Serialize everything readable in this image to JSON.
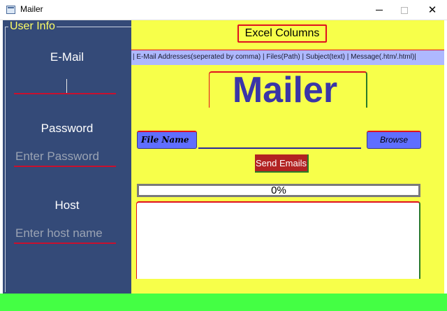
{
  "window": {
    "title": "Mailer"
  },
  "user_info": {
    "group_title": "User Info",
    "email_label": "E-Mail",
    "email_value": "",
    "password_label": "Password",
    "password_placeholder": "Enter Password",
    "host_label": "Host",
    "host_placeholder": "Enter host name"
  },
  "main": {
    "excel_button": "Excel  Columns",
    "columns_text": "| E-Mail Addresses(seperated by comma) | Files(Path) |  Subject(text) |  Message(.htm/.html)|",
    "mailer_title": "Mailer",
    "file_name_label": "File Name",
    "file_name_value": "",
    "browse_button": "Browse",
    "send_button": "Send Emails",
    "progress_percent": 0,
    "progress_text": "0%",
    "log_text": ""
  },
  "colors": {
    "left_panel": "#344a78",
    "right_panel": "#f7ff4a",
    "accent_red": "#e0101f",
    "button_blue": "#5f6eff",
    "send_red": "#b22222",
    "bottom_bar": "#44ff44",
    "group_title": "#ffff66"
  },
  "icons": {
    "app": "window-app-icon",
    "minimize": "minimize-icon",
    "maximize": "maximize-icon",
    "close": "close-icon"
  }
}
